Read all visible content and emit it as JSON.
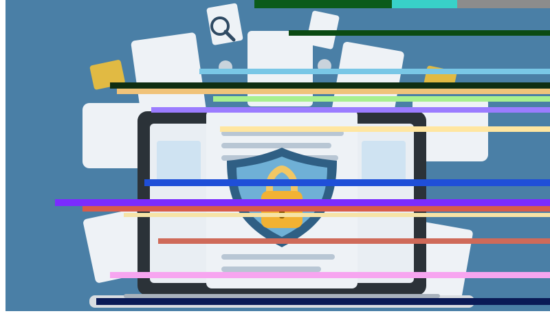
{
  "scene": {
    "subject": "laptop-with-security-shield",
    "colors": {
      "background": "#4a7fa6",
      "laptop_frame": "#2b3238",
      "screen_bg": "#e9eef3",
      "shield_outer": "#2f5f84",
      "shield_inner": "#6fb0d6",
      "lock_body": "#f2b233",
      "lock_shackle": "#f2c763",
      "paper": "#eef2f6",
      "paper_line": "#b8c6d4",
      "folder_yellow": "#e1ba43",
      "gear": "#c9d3dc"
    }
  }
}
